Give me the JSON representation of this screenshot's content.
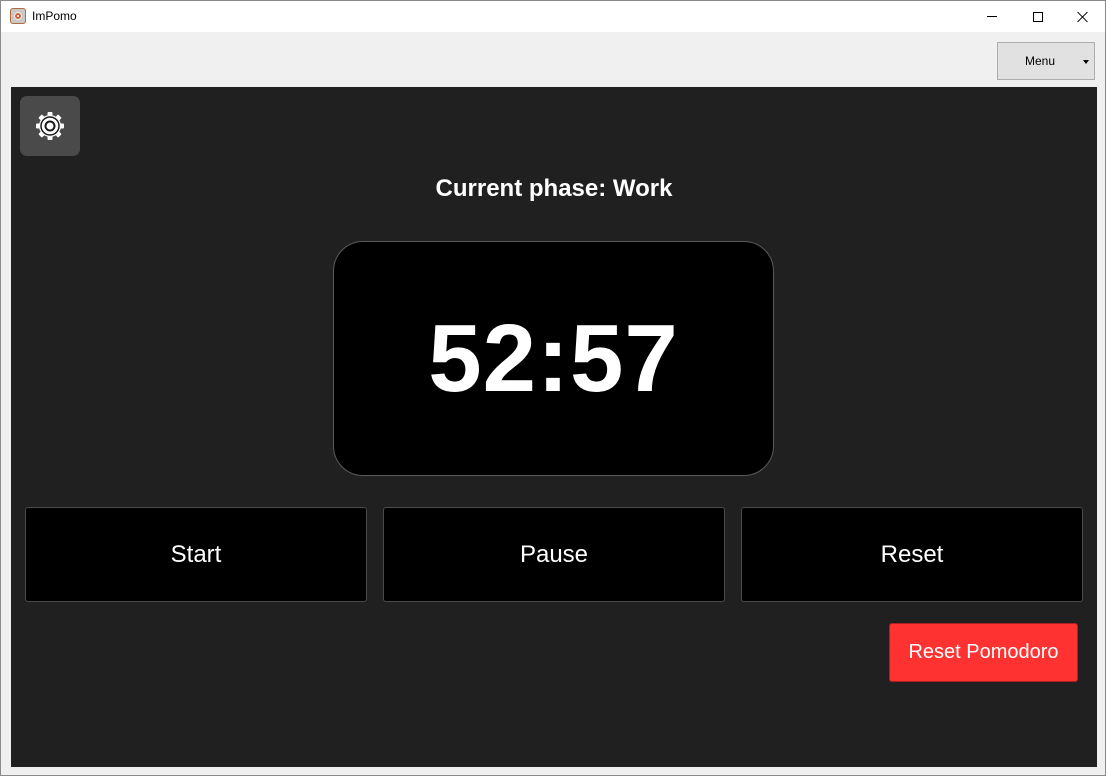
{
  "window": {
    "title": "ImPomo",
    "controls": {
      "minimize": "minimize-icon",
      "maximize": "maximize-icon",
      "close": "close-icon"
    }
  },
  "menubar": {
    "menu_label": "Menu"
  },
  "main": {
    "settings_icon": "gear-icon",
    "phase_text": "Current phase: Work",
    "timer": "52:57",
    "buttons": {
      "start": "Start",
      "pause": "Pause",
      "reset": "Reset",
      "reset_pomodoro": "Reset Pomodoro"
    }
  },
  "colors": {
    "panel_bg": "#202020",
    "timer_bg": "#000000",
    "accent_red": "#ff3232",
    "settings_bg": "#4a4a4a"
  }
}
